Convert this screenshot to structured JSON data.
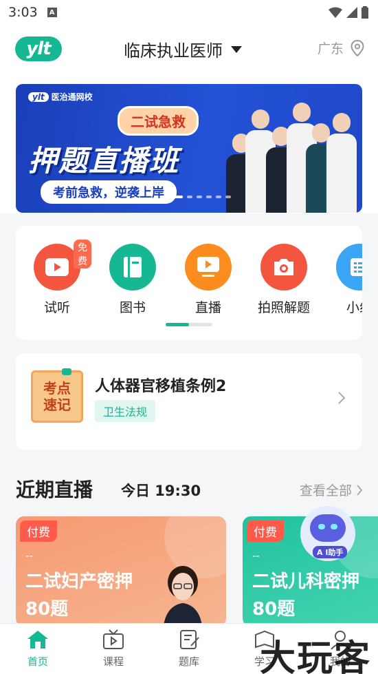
{
  "status_bar": {
    "time": "3:03",
    "notif_icon": "A"
  },
  "header": {
    "exam_type": "临床执业医师",
    "location": "广东",
    "logo": "ylt"
  },
  "banner": {
    "brand": "医治通网校",
    "tag": "二试急救",
    "title": "押题直播班",
    "subtitle": "考前急救，逆袭上岸",
    "page_count": 6,
    "active_index": 0
  },
  "quick_menu": {
    "items": [
      {
        "label": "试听",
        "icon": "play-icon",
        "color": "#f4553f",
        "badge": "免费"
      },
      {
        "label": "图书",
        "icon": "book-icon",
        "color": "#15b893"
      },
      {
        "label": "直播",
        "icon": "live-icon",
        "color": "#fb8c1e"
      },
      {
        "label": "拍照解题",
        "icon": "camera-icon",
        "color": "#f4553f"
      },
      {
        "label": "小组",
        "icon": "list-icon",
        "color": "#3aa4f5"
      }
    ]
  },
  "knowledge": {
    "badge_line1": "考点",
    "badge_line2": "速记",
    "title": "人体器官移植条例2",
    "tag": "卫生法规"
  },
  "live_section": {
    "heading": "近期直播",
    "time": "今日 19:30",
    "view_all": "查看全部",
    "cards": [
      {
        "badge": "付费",
        "dash": "--",
        "title": "二试妇产密押",
        "count": "80题"
      },
      {
        "badge": "付费",
        "dash": "--",
        "title": "二试儿科密押",
        "count": "80题"
      }
    ]
  },
  "ai_assistant": {
    "label": "A I助手"
  },
  "tab_bar": {
    "tabs": [
      {
        "label": "首页",
        "icon": "home-icon",
        "active": true
      },
      {
        "label": "课程",
        "icon": "tv-icon",
        "active": false
      },
      {
        "label": "题库",
        "icon": "edit-icon",
        "active": false
      },
      {
        "label": "学习",
        "icon": "study-icon",
        "active": false
      },
      {
        "label": "我的",
        "icon": "user-icon",
        "active": false
      }
    ]
  },
  "watermark": "大玩客",
  "colors": {
    "brand": "#15b893",
    "accent_red": "#f4553f"
  }
}
